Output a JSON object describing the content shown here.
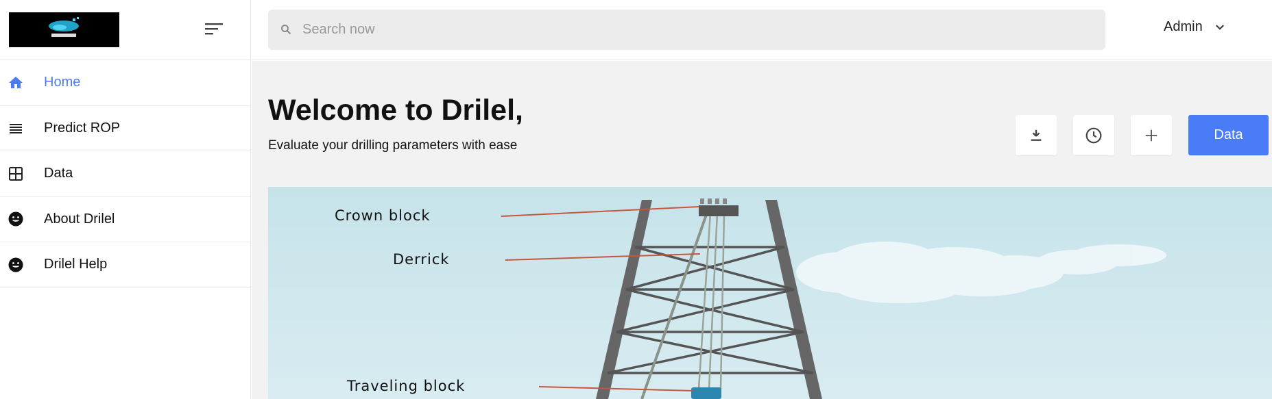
{
  "app": {
    "logo_text": "DRILEL"
  },
  "sidebar": {
    "items": [
      {
        "label": "Home",
        "icon": "home-icon",
        "active": true
      },
      {
        "label": "Predict ROP",
        "icon": "list-icon",
        "active": false
      },
      {
        "label": "Data",
        "icon": "grid-icon",
        "active": false
      },
      {
        "label": "About Drilel",
        "icon": "smiley-icon",
        "active": false
      },
      {
        "label": "Drilel Help",
        "icon": "smiley-icon",
        "active": false
      }
    ]
  },
  "header": {
    "search_placeholder": "Search now",
    "user_name": "Admin"
  },
  "main": {
    "title": "Welcome to Drilel,",
    "subtitle": "Evaluate your drilling parameters with ease",
    "actions": {
      "download_icon": "download-icon",
      "history_icon": "clock-icon",
      "add_icon": "plus-icon",
      "data_label": "Data"
    },
    "illustration": {
      "labels": {
        "crown_block": "Crown block",
        "derrick": "Derrick",
        "traveling_block": "Traveling block"
      }
    }
  },
  "colors": {
    "accent": "#4a7cf8",
    "active_nav": "#4a7cf0",
    "sky": "#cfe7ee",
    "leader_line": "#c8553d"
  }
}
